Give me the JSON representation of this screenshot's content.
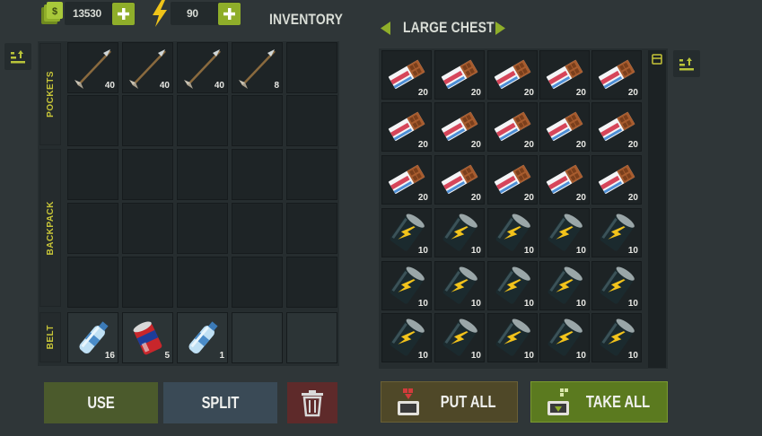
{
  "header": {
    "coins": "13530",
    "energy": "90",
    "inventory_title": "INVENTORY",
    "chest_title": "LARGE CHEST"
  },
  "inventory": {
    "sections": {
      "pockets": "POCKETS",
      "backpack": "BACKPACK",
      "belt": "BELT"
    },
    "pockets": [
      {
        "item": "arrow",
        "count": "40"
      },
      {
        "item": "arrow",
        "count": "40"
      },
      {
        "item": "arrow",
        "count": "40"
      },
      {
        "item": "arrow",
        "count": "8"
      },
      {
        "item": "",
        "count": ""
      }
    ],
    "belt": [
      {
        "item": "water-bottle",
        "count": "16"
      },
      {
        "item": "soda-can",
        "count": "5"
      },
      {
        "item": "water-bottle",
        "count": "1"
      },
      {
        "item": "",
        "count": ""
      },
      {
        "item": "",
        "count": ""
      }
    ]
  },
  "chest": {
    "rows": [
      [
        {
          "item": "chocolate-bar",
          "count": "20"
        },
        {
          "item": "chocolate-bar",
          "count": "20"
        },
        {
          "item": "chocolate-bar",
          "count": "20"
        },
        {
          "item": "chocolate-bar",
          "count": "20"
        },
        {
          "item": "chocolate-bar",
          "count": "20"
        }
      ],
      [
        {
          "item": "chocolate-bar",
          "count": "20"
        },
        {
          "item": "chocolate-bar",
          "count": "20"
        },
        {
          "item": "chocolate-bar",
          "count": "20"
        },
        {
          "item": "chocolate-bar",
          "count": "20"
        },
        {
          "item": "chocolate-bar",
          "count": "20"
        }
      ],
      [
        {
          "item": "chocolate-bar",
          "count": "20"
        },
        {
          "item": "chocolate-bar",
          "count": "20"
        },
        {
          "item": "chocolate-bar",
          "count": "20"
        },
        {
          "item": "chocolate-bar",
          "count": "20"
        },
        {
          "item": "chocolate-bar",
          "count": "20"
        }
      ],
      [
        {
          "item": "energy-drink",
          "count": "10"
        },
        {
          "item": "energy-drink",
          "count": "10"
        },
        {
          "item": "energy-drink",
          "count": "10"
        },
        {
          "item": "energy-drink",
          "count": "10"
        },
        {
          "item": "energy-drink",
          "count": "10"
        }
      ],
      [
        {
          "item": "energy-drink",
          "count": "10"
        },
        {
          "item": "energy-drink",
          "count": "10"
        },
        {
          "item": "energy-drink",
          "count": "10"
        },
        {
          "item": "energy-drink",
          "count": "10"
        },
        {
          "item": "energy-drink",
          "count": "10"
        }
      ],
      [
        {
          "item": "energy-drink",
          "count": "10"
        },
        {
          "item": "energy-drink",
          "count": "10"
        },
        {
          "item": "energy-drink",
          "count": "10"
        },
        {
          "item": "energy-drink",
          "count": "10"
        },
        {
          "item": "energy-drink",
          "count": "10"
        }
      ]
    ]
  },
  "actions": {
    "use": "USE",
    "split": "SPLIT",
    "put_all": "PUT ALL",
    "take_all": "TAKE ALL"
  },
  "colors": {
    "accent_green": "#8fae2a",
    "label_yellow": "#c7c538",
    "use_bg": "#4b5a2c",
    "split_bg": "#3a4a56",
    "delete_bg": "#6a2a2a",
    "put_all_bg": "#5a4d2a",
    "take_all_bg": "#5b7a1f"
  },
  "icons": {
    "coins": "coins-icon",
    "energy": "lightning-icon",
    "plus": "plus-icon",
    "trash": "trash-icon",
    "sort": "sort-icon",
    "arrow_left": "chevron-left-icon",
    "arrow_right": "chevron-right-icon"
  }
}
